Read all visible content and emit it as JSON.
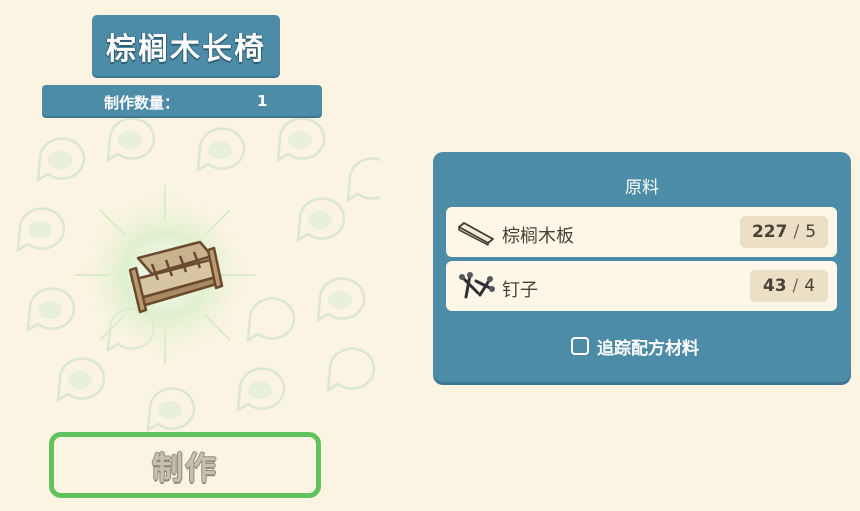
{
  "recipe": {
    "title": "棕榈木长椅",
    "quantity_label": "制作数量：",
    "quantity_value": "1",
    "item_icon": "wooden-bench-icon",
    "craft_button_label": "制作"
  },
  "materials_panel": {
    "title": "原料",
    "items": [
      {
        "icon": "palm-plank-icon",
        "name": "棕榈木板",
        "have": "227",
        "separator": "/",
        "need": "5"
      },
      {
        "icon": "nails-icon",
        "name": "钉子",
        "have": "43",
        "separator": "/",
        "need": "4"
      }
    ],
    "track_label": "追踪配方材料",
    "track_checked": false
  },
  "colors": {
    "panel_blue": "#4d8ca7",
    "background_cream": "#fbf4e2",
    "button_green": "#5fc25a",
    "text_brown": "#4a4236"
  }
}
